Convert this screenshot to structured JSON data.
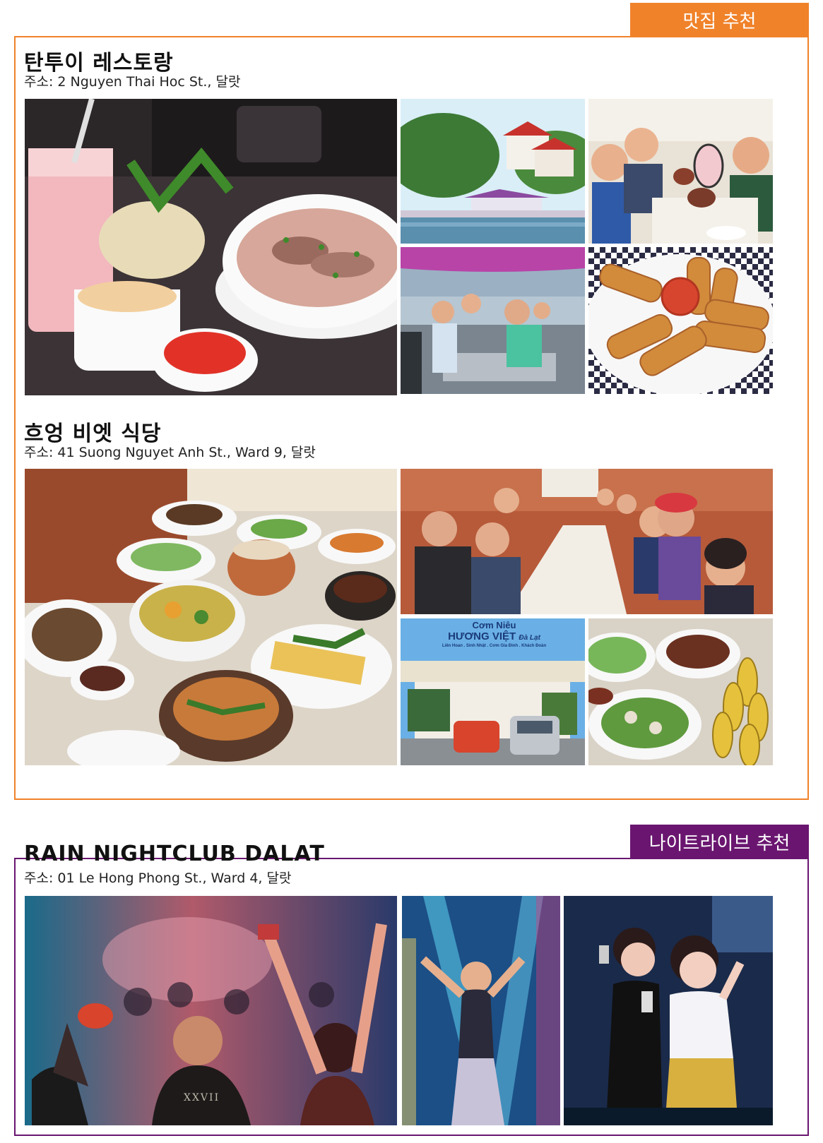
{
  "food_section": {
    "tab_label": "맛집 추천",
    "accent_color": "#f0822a"
  },
  "nightlife_section": {
    "tab_label": "나이트라이브 추천",
    "accent_color": "#6a1670"
  },
  "places": [
    {
      "name": "탄투이 레스토랑",
      "address": "주소: 2 Nguyen Thai Hoc St., 달랏"
    },
    {
      "name": "흐엉 비엣 식당",
      "address": "주소: 41 Suong Nguyet Anh St., Ward 9, 달랏"
    },
    {
      "name": "RAIN NIGHTCLUB DALAT",
      "address": "주소: 01 Le Hong Phong St., Ward 4, 달랏"
    }
  ],
  "signboard": {
    "line1": "Cơm Niêu",
    "line2": "HƯƠNG VIỆT",
    "script": "Đà Lạt",
    "line3": "Liên Hoan . Sinh Nhật . Cơm Gia Đình . Khách Đoàn"
  },
  "shirt_text": "XXVII"
}
